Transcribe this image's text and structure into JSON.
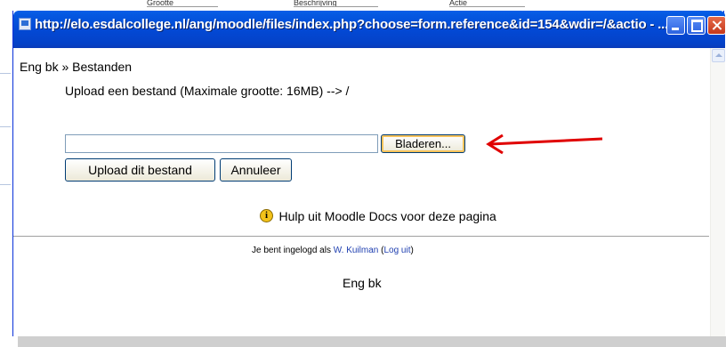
{
  "background": {
    "head_cells": [
      "Grootte",
      "Beschrijving",
      "Actie"
    ]
  },
  "window": {
    "title": "http://elo.esdalcollege.nl/ang/moodle/files/index.php?choose=form.reference&id=154&wdir=/&actio - ...",
    "controls": {
      "minimize_icon": "minimize-icon",
      "maximize_icon": "maximize-icon",
      "close_icon": "close-icon"
    }
  },
  "page": {
    "breadcrumb": "Eng bk » Bestanden",
    "upload_info": "Upload een bestand (Maximale grootte: 16MB) --> /",
    "file_input_value": "",
    "browse_label": "Bladeren...",
    "upload_label": "Upload dit bestand",
    "cancel_label": "Annuleer",
    "help_link": "Hulp uit Moodle Docs voor deze pagina",
    "login_prefix": "Je bent ingelogd als",
    "user_name": "W. Kuilman",
    "logout_open": "(",
    "logout_label": "Log uit",
    "logout_close": ")",
    "footer_course": "Eng bk"
  },
  "colors": {
    "titlebar": "#0349d5",
    "arrow": "#e00000",
    "link": "#1f3fb0",
    "help_icon": "#f2c21a"
  }
}
